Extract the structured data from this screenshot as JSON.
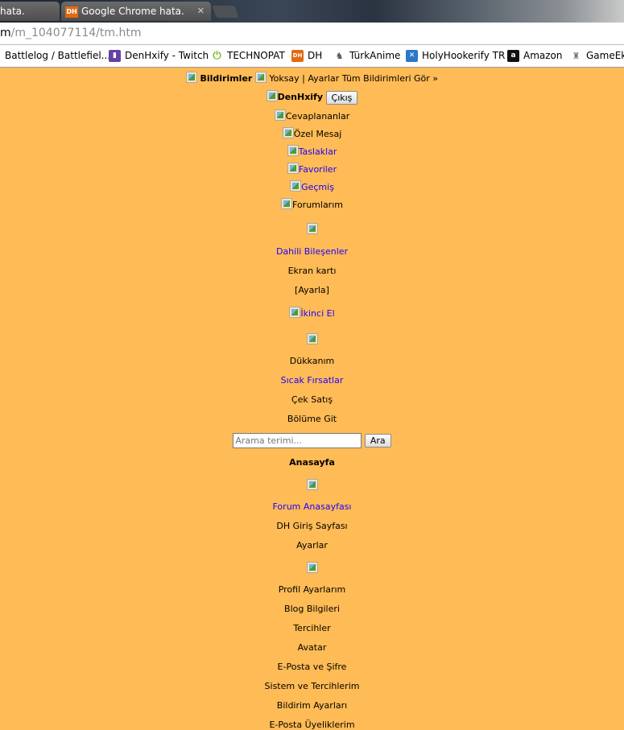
{
  "tabs": [
    {
      "label": "hata."
    },
    {
      "label": "Google Chrome hata.",
      "favicon": "DH"
    }
  ],
  "url": {
    "host": "m",
    "path": "/m_104077114/tm.htm"
  },
  "bookmarks": [
    {
      "label": "Battlelog / Battlefiel..."
    },
    {
      "label": "DenHxify - Twitch",
      "icon": "twitch-icon",
      "color": "#6441a5"
    },
    {
      "label": "TECHNOPAT",
      "icon": "power-icon",
      "color": "#7cba2a"
    },
    {
      "label": "DH",
      "icon": "DH",
      "color": "#e06a12"
    },
    {
      "label": "TürkAnime",
      "icon": "turkanime-icon",
      "color": "#5a5a5a"
    },
    {
      "label": "HolyHookerify TR",
      "icon": "holy-icon",
      "color": "#2a77c9"
    },
    {
      "label": "Amazon",
      "icon": "a",
      "color": "#111111"
    },
    {
      "label": "GameEks",
      "icon": "gameeks-icon",
      "color": "#777777"
    }
  ],
  "notifications": {
    "title": "Bildirimler",
    "links": "Yoksay | Ayarlar Tüm Bildirimleri Gör »"
  },
  "user": {
    "name": "DenHxify",
    "logout": "Çıkış"
  },
  "menu": {
    "answered": "Cevaplananlar",
    "pm": "Özel Mesaj",
    "drafts": "Taslaklar",
    "favorites": "Favoriler",
    "history": "Geçmiş",
    "my_forums": "Forumlarım",
    "components": "Dahili Bileşenler",
    "gpu": "Ekran kartı",
    "settings_bracket": "[Ayarla]",
    "second_hand": "İkinci El",
    "my_shop": "Dükkanım",
    "hot_deals": "Sıcak Fırsatlar",
    "cek_satis": "Çek Satış",
    "go_section": "Bölüme Git",
    "home_title": "Anasayfa",
    "forum_home": "Forum Anasayfası",
    "dh_login": "DH Giriş Sayfası",
    "settings": "Ayarlar",
    "profile_settings": "Profil Ayarlarım",
    "blog_info": "Blog Bilgileri",
    "preferences": "Tercihler",
    "avatar": "Avatar",
    "email_pass": "E-Posta ve Şifre",
    "system_prefs": "Sistem ve Tercihlerim",
    "notif_settings": "Bildirim Ayarları",
    "email_subs": "E-Posta Üyeliklerim"
  },
  "search": {
    "placeholder": "Arama terimi...",
    "button": "Ara"
  },
  "colors": {
    "page_bg": "#ffbb55",
    "link": "#1d00ff"
  }
}
